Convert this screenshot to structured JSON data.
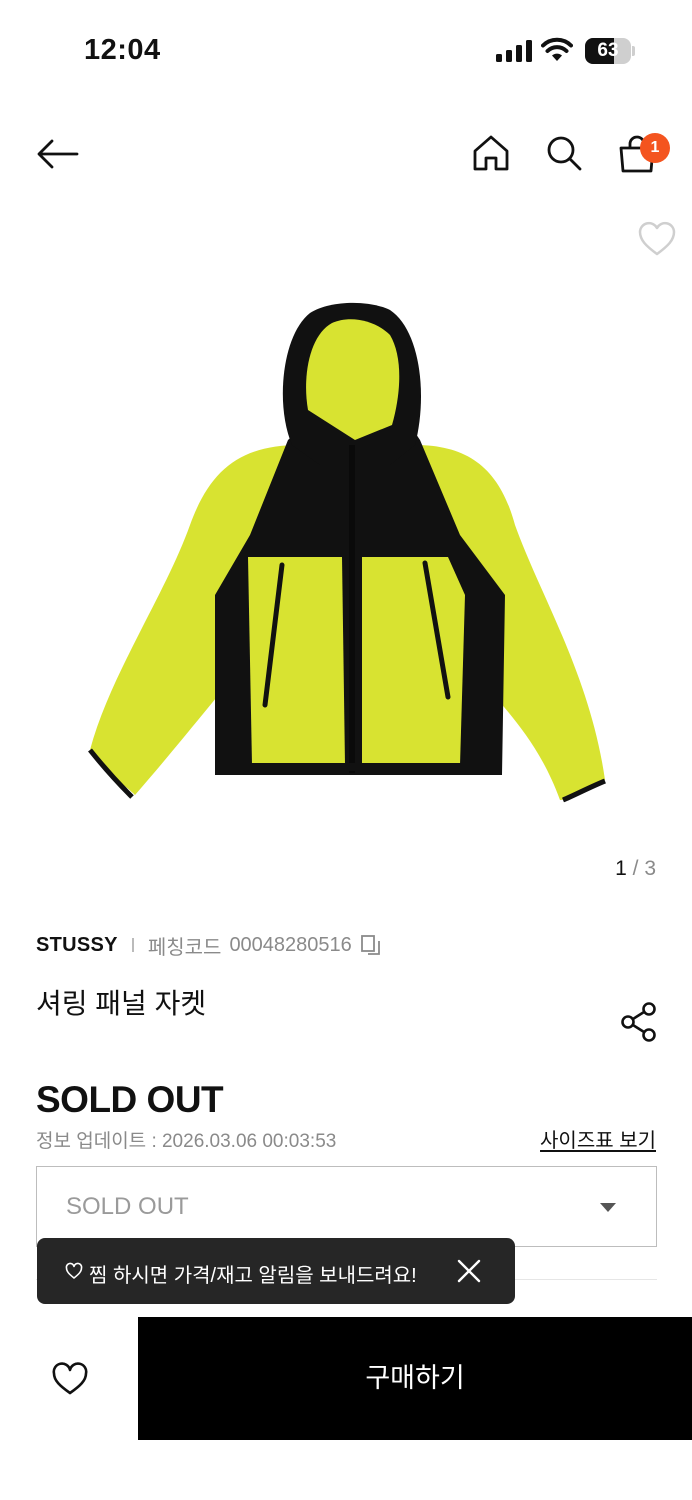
{
  "status_bar": {
    "time": "12:04",
    "battery": "63",
    "battery_level_percent": 63
  },
  "header": {
    "back_icon": "arrow-left-icon",
    "home_icon": "home-icon",
    "search_icon": "search-icon",
    "cart_icon": "shopping-bag-icon",
    "cart_count": "1",
    "badge_color": "#f4541f"
  },
  "gallery": {
    "current": "1",
    "separator": "/",
    "total": "3",
    "wish_icon": "heart-outline-icon",
    "image_colors": {
      "body": "#d8e331",
      "panel": "#111111"
    }
  },
  "product": {
    "brand": "STUSSY",
    "code_label": "페칭코드",
    "code": "00048280516",
    "name": "셔링 패널 자켓",
    "price": "SOLD OUT",
    "updated": "정보 업데이트 : 2026.03.06 00:03:53",
    "size_chart": "사이즈표 보기",
    "option_value": "SOLD OUT"
  },
  "toast": {
    "text": "찜 하시면 가격/재고 알림을 보내드려요!",
    "close_icon": "close-icon"
  },
  "bottom_bar": {
    "wish_icon": "heart-outline-icon",
    "buy_label": "구매하기"
  }
}
